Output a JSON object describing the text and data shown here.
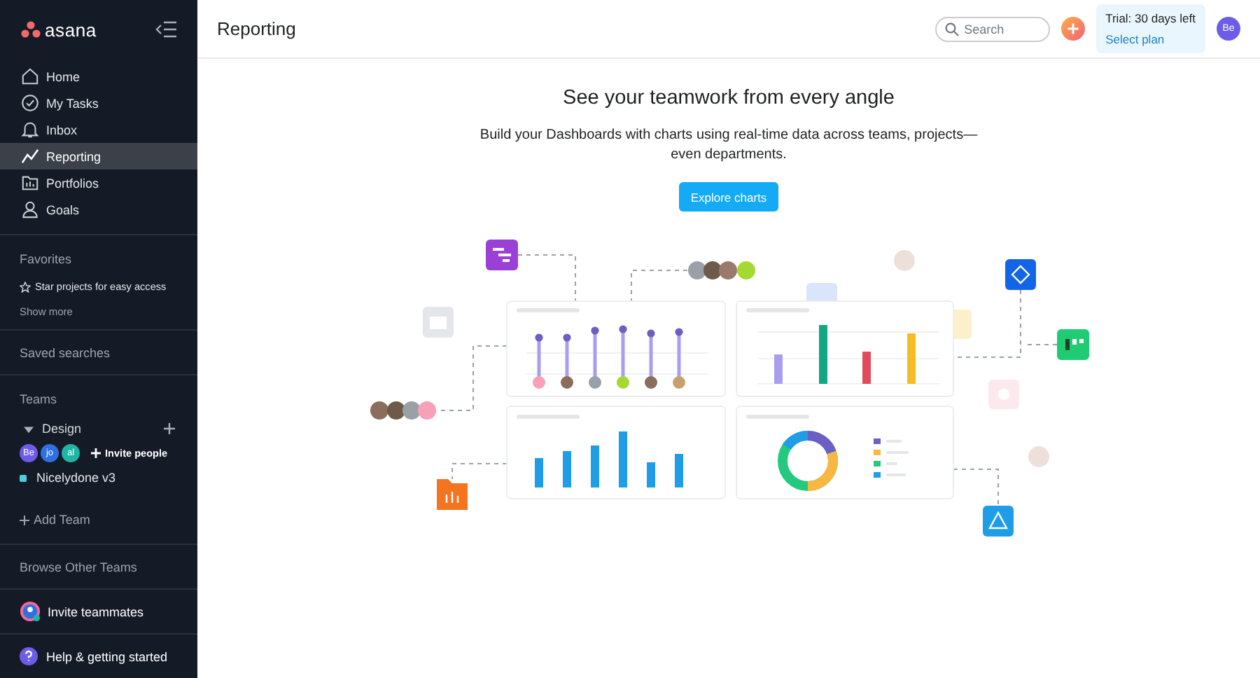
{
  "sidebar": {
    "logo": "asana",
    "nav": [
      {
        "label": "Home",
        "kind": "home",
        "selected": false
      },
      {
        "label": "My Tasks",
        "kind": "tasks",
        "selected": false
      },
      {
        "label": "Inbox",
        "kind": "inbox",
        "selected": false
      },
      {
        "label": "Reporting",
        "kind": "reporting",
        "selected": true
      },
      {
        "label": "Portfolios",
        "kind": "portfolios",
        "selected": false
      },
      {
        "label": "Goals",
        "kind": "goals",
        "selected": false
      }
    ],
    "favorites": {
      "heading": "Favorites",
      "hint": "Star projects for easy access",
      "more": "Show more"
    },
    "saved_searches": "Saved searches",
    "teams": {
      "heading": "Teams",
      "team": {
        "name": "Design",
        "expanded": true,
        "members": [
          {
            "initials": "Be",
            "color": "#6d5ce8"
          },
          {
            "initials": "jo",
            "color": "#2f6fe0"
          },
          {
            "initials": "al",
            "color": "#1fb5a5"
          }
        ],
        "invite": "Invite people"
      },
      "projects": [
        {
          "name": "Nicelydone v3",
          "color": "#4ecbe0"
        }
      ],
      "add": "Add Team"
    },
    "browse": "Browse Other Teams",
    "invite_teammates": "Invite teammates",
    "help": "Help & getting started"
  },
  "header": {
    "title": "Reporting",
    "search": {
      "placeholder": "Search"
    },
    "trial": {
      "text": "Trial: 30 days left",
      "link": "Select plan"
    },
    "user": "Be"
  },
  "hero": {
    "heading": "See your teamwork from every angle",
    "description": "Build your Dashboards with charts using real-time data across teams, projects—even departments.",
    "button": "Explore charts"
  }
}
